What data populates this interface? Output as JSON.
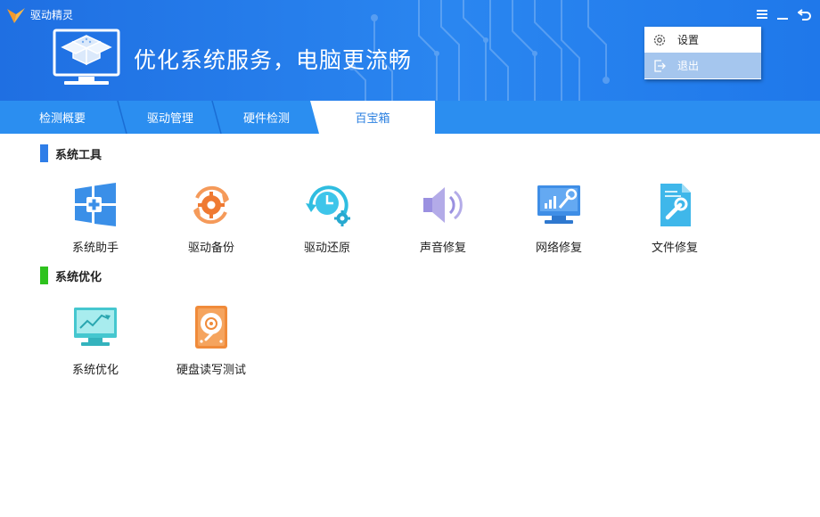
{
  "app": {
    "name": "驱动精灵",
    "slogan": "优化系统服务，电脑更流畅"
  },
  "window_controls": [
    {
      "name": "menu-icon"
    },
    {
      "name": "minimize-icon"
    },
    {
      "name": "back-icon"
    }
  ],
  "tabs": [
    {
      "label": "检测概要",
      "active": false
    },
    {
      "label": "驱动管理",
      "active": false
    },
    {
      "label": "硬件检测",
      "active": false
    },
    {
      "label": "百宝箱",
      "active": true
    }
  ],
  "menu": {
    "items": [
      {
        "label": "设置",
        "icon": "gear-icon"
      },
      {
        "label": "退出",
        "icon": "exit-icon"
      }
    ]
  },
  "sections": [
    {
      "title": "系统工具",
      "accent": "#2f7ee8",
      "tools": [
        {
          "label": "系统助手",
          "icon": "windows-plus-icon"
        },
        {
          "label": "驱动备份",
          "icon": "gear-backup-icon"
        },
        {
          "label": "驱动还原",
          "icon": "clock-restore-icon"
        },
        {
          "label": "声音修复",
          "icon": "speaker-icon"
        },
        {
          "label": "网络修复",
          "icon": "monitor-wrench-icon"
        },
        {
          "label": "文件修复",
          "icon": "file-wrench-icon"
        }
      ]
    },
    {
      "title": "系统优化",
      "accent": "#2ec21e",
      "tools": [
        {
          "label": "系统优化",
          "icon": "monitor-chart-icon"
        },
        {
          "label": "硬盘读写测试",
          "icon": "hard-disk-icon"
        }
      ]
    }
  ]
}
